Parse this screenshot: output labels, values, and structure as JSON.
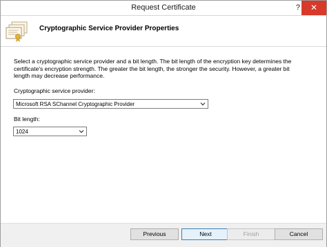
{
  "window": {
    "title": "Request Certificate",
    "help_glyph": "?",
    "close_glyph": "✕"
  },
  "header": {
    "icon": "certificates-icon",
    "title": "Cryptographic Service Provider Properties"
  },
  "content": {
    "description": "Select a cryptographic service provider and a bit length. The bit length of the encryption key determines the certificate's encryption strength. The greater the bit length, the stronger the security. However, a greater bit length may decrease performance.",
    "provider_label": "Cryptographic service provider:",
    "provider_value": "Microsoft RSA SChannel Cryptographic Provider",
    "bit_length_label": "Bit length:",
    "bit_length_value": "1024"
  },
  "footer": {
    "previous_label": "Previous",
    "next_label": "Next",
    "finish_label": "Finish",
    "cancel_label": "Cancel"
  },
  "colors": {
    "close_button": "#d7392a",
    "default_button_border": "#3c7fb1",
    "footer_background": "#f0f0f0"
  }
}
